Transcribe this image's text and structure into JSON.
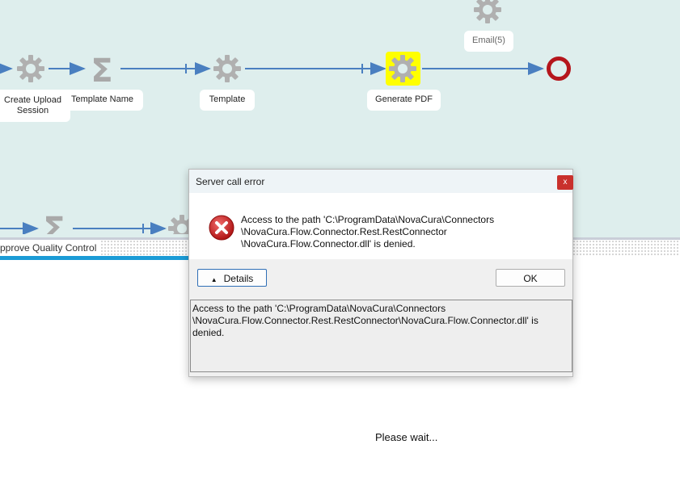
{
  "flow": {
    "nodes": [
      {
        "label": "Create Upload Session",
        "icon": "gear-icon"
      },
      {
        "label": "Template Name",
        "icon": "sigma-icon"
      },
      {
        "label": "Template",
        "icon": "gear-icon"
      },
      {
        "label": "Generate PDF",
        "icon": "gear-icon",
        "highlight": "#ffff00"
      },
      {
        "label": "Email(5)",
        "icon": "gear-icon"
      },
      {
        "label": "",
        "icon": "end-event-icon"
      }
    ],
    "lane_label": "pprove Quality Control",
    "colors": {
      "canvas": "#deeeed",
      "arrow": "#4a7fc0",
      "gear": "#b0b0b0",
      "end_event": "#b5161c",
      "lane_bar": "#1b9bd6"
    }
  },
  "dialog": {
    "title": "Server call error",
    "close_label": "x",
    "message_line1": "Access to the path 'C:\\ProgramData\\NovaCura\\Connectors",
    "message_line2": "\\NovaCura.Flow.Connector.Rest.RestConnector",
    "message_line3": "\\NovaCura.Flow.Connector.dll' is denied.",
    "details_label": "Details",
    "ok_label": "OK",
    "details_line1": "Access to the path 'C:\\ProgramData\\NovaCura\\Connectors",
    "details_line2": "\\NovaCura.Flow.Connector.Rest.RestConnector\\NovaCura.Flow.Connector.dll' is denied."
  },
  "status": {
    "wait_text": "Please wait..."
  }
}
